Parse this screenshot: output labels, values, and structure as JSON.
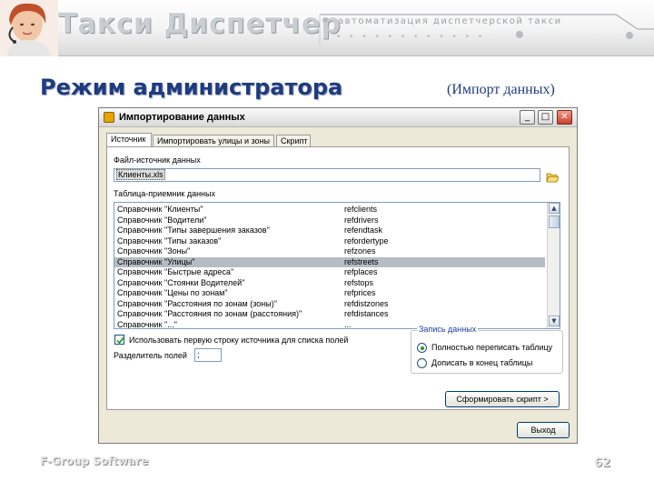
{
  "slide": {
    "logo": "Такси Диспетчер",
    "tagline": "автоматизация диспетчерской такси",
    "title": "Режим администратора",
    "subtitle": "(Импорт данных)",
    "footer_brand": "F-Group Software",
    "page_number": "62"
  },
  "window": {
    "title": "Импортирование данных",
    "controls": {
      "minimize": "_",
      "maximize": "□",
      "close": "✕"
    },
    "tabs": [
      "Источник",
      "Импортировать улицы и зоны",
      "Скрипт"
    ],
    "active_tab": 0,
    "source": {
      "label": "Файл-источник данных",
      "value": "Клиенты.xls"
    },
    "table": {
      "label": "Таблица-приемник данных",
      "selected_index": 5,
      "rows": [
        {
          "name": "Справочник \"Клиенты\"",
          "target": "refclients"
        },
        {
          "name": "Справочник \"Водители\"",
          "target": "refdrivers"
        },
        {
          "name": "Справочник \"Типы завершения заказов\"",
          "target": "refendtask"
        },
        {
          "name": "Справочник \"Типы заказов\"",
          "target": "refordertype"
        },
        {
          "name": "Справочник \"Зоны\"",
          "target": "refzones"
        },
        {
          "name": "Справочник \"Улицы\"",
          "target": "refstreets"
        },
        {
          "name": "Справочник \"Быстрые адреса\"",
          "target": "refplaces"
        },
        {
          "name": "Справочник \"Стоянки Водителей\"",
          "target": "refstops"
        },
        {
          "name": "Справочник \"Цены по зонам\"",
          "target": "refprices"
        },
        {
          "name": "Справочник \"Расстояния по зонам (зоны)\"",
          "target": "refdistzones"
        },
        {
          "name": "Справочник \"Расстояния по зонам (расстояния)\"",
          "target": "refdistances"
        },
        {
          "name": "Справочник \"...\"",
          "target": "..."
        }
      ]
    },
    "use_first_row": {
      "label": "Использовать первую строку источника для списка полей",
      "checked": true
    },
    "separator": {
      "label": "Разделитель полей",
      "value": ";"
    },
    "write_mode": {
      "title": "Запись данных",
      "options": [
        "Полностью переписать таблицу",
        "Дописать в конец таблицы"
      ],
      "selected": 0
    },
    "generate_button": "Сформировать скрипт >",
    "exit_button": "Выход"
  },
  "colors": {
    "title_blue": "#1f3b80",
    "selection": "#b6bcc4",
    "window_bg": "#ece9d8"
  },
  "icons": [
    "operator-photo",
    "folder-icon",
    "checkmark-icon",
    "window-app-icon"
  ]
}
